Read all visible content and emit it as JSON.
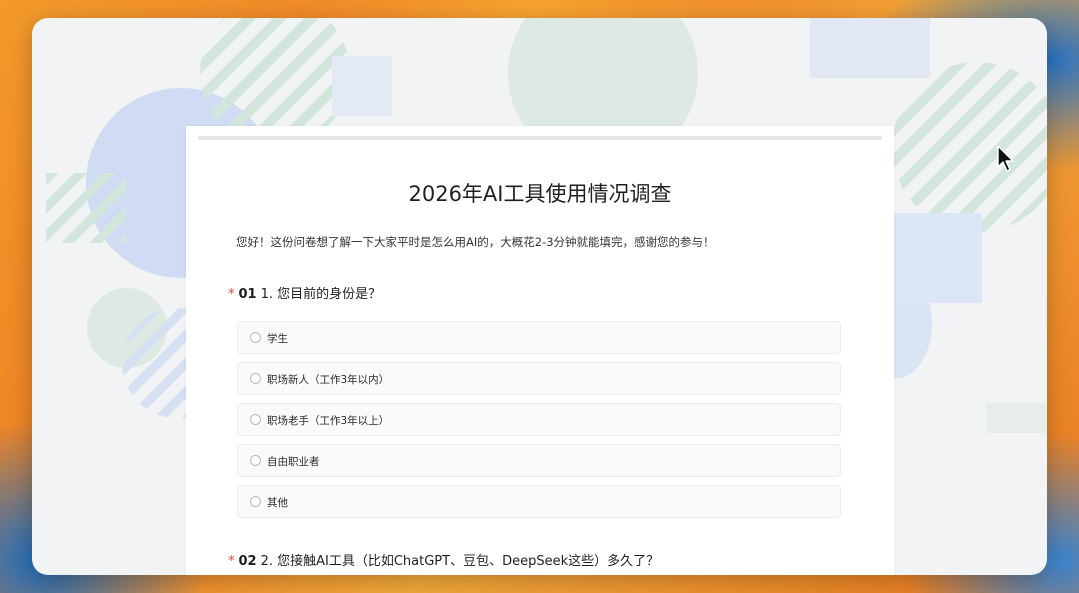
{
  "form": {
    "title": "2026年AI工具使用情况调查",
    "intro": "您好！这份问卷想了解一下大家平时是怎么用AI的，大概花2-3分钟就能填完，感谢您的参与！"
  },
  "questions": [
    {
      "required_mark": "*",
      "number": "01",
      "text": "1. 您目前的身份是？",
      "options": [
        "学生",
        "职场新人（工作3年以内）",
        "职场老手（工作3年以上）",
        "自由职业者",
        "其他"
      ]
    },
    {
      "required_mark": "*",
      "number": "02",
      "text": "2. 您接触AI工具（比如ChatGPT、豆包、DeepSeek这些）多久了？"
    }
  ],
  "icons": {
    "cursor": "mouse-pointer-icon",
    "radio": "radio-circle-icon"
  },
  "colors": {
    "required": "#e0473b",
    "card": "#ffffff",
    "window_bg": "#f2f3f5"
  }
}
